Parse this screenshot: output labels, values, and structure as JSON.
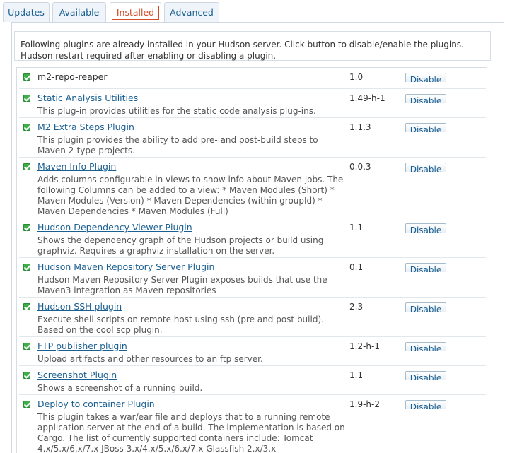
{
  "tabs": [
    {
      "label": "Updates",
      "active": false
    },
    {
      "label": "Available",
      "active": false
    },
    {
      "label": "Installed",
      "active": true
    },
    {
      "label": "Advanced",
      "active": false
    }
  ],
  "info": {
    "line1": "Following plugins are already installed in your Hudson server. Click button to disable/enable the plugins.",
    "line2": "Hudson restart required after enabling or disabling a plugin."
  },
  "disable_label": "Disable",
  "plugins": [
    {
      "name": "m2-repo-reaper",
      "version": "1.0",
      "desc": "",
      "link": false,
      "enabled": true
    },
    {
      "name": "Static Analysis Utilities",
      "version": "1.49-h-1",
      "desc": "This plug-in provides utilities for the static code analysis plug-ins.",
      "link": true,
      "enabled": true
    },
    {
      "name": "M2 Extra Steps Plugin",
      "version": "1.1.3",
      "desc": "This plugin provides the ability to add pre- and post-build steps to Maven 2-type projects.",
      "link": true,
      "enabled": true
    },
    {
      "name": "Maven Info Plugin",
      "version": "0.0.3",
      "desc": "Adds columns configurable in views to show info about Maven jobs. The following Columns can be added to a view: * Maven Modules (Short) * Maven Modules (Version) * Maven Dependencies (within groupId) * Maven Dependencies * Maven Modules (Full)",
      "link": true,
      "enabled": true
    },
    {
      "name": "Hudson Dependency Viewer Plugin",
      "version": "1.1",
      "desc": "Shows the dependency graph of the Hudson projects or build using graphviz. Requires a graphviz installation on the server.",
      "link": true,
      "enabled": true
    },
    {
      "name": "Hudson Maven Repository Server Plugin",
      "version": "0.1",
      "desc": "Hudson Maven Repository Server Plugin exposes builds that use the Maven3 integration as Maven repositories",
      "link": true,
      "enabled": true
    },
    {
      "name": "Hudson SSH plugin",
      "version": "2.3",
      "desc": "Execute shell scripts on remote host using ssh (pre and post build). Based on the cool scp plugin.",
      "link": true,
      "enabled": true
    },
    {
      "name": "FTP publisher plugin",
      "version": "1.2-h-1",
      "desc": "Upload artifacts and other resources to an ftp server.",
      "link": true,
      "enabled": true
    },
    {
      "name": "Screenshot Plugin",
      "version": "1.1",
      "desc": "Shows a screenshot of a running build.",
      "link": true,
      "enabled": true
    },
    {
      "name": "Deploy to container Plugin",
      "version": "1.9-h-2",
      "desc": "This plugin takes a war/ear file and deploys that to a running remote application server at the end of a build. The implementation is based on Cargo. The list of currently supported containers include: Tomcat 4.x/5.x/6.x/7.x JBoss 3.x/4.x/5.x/6.x/7.x Glassfish 2.x/3.x",
      "link": true,
      "enabled": true
    }
  ]
}
